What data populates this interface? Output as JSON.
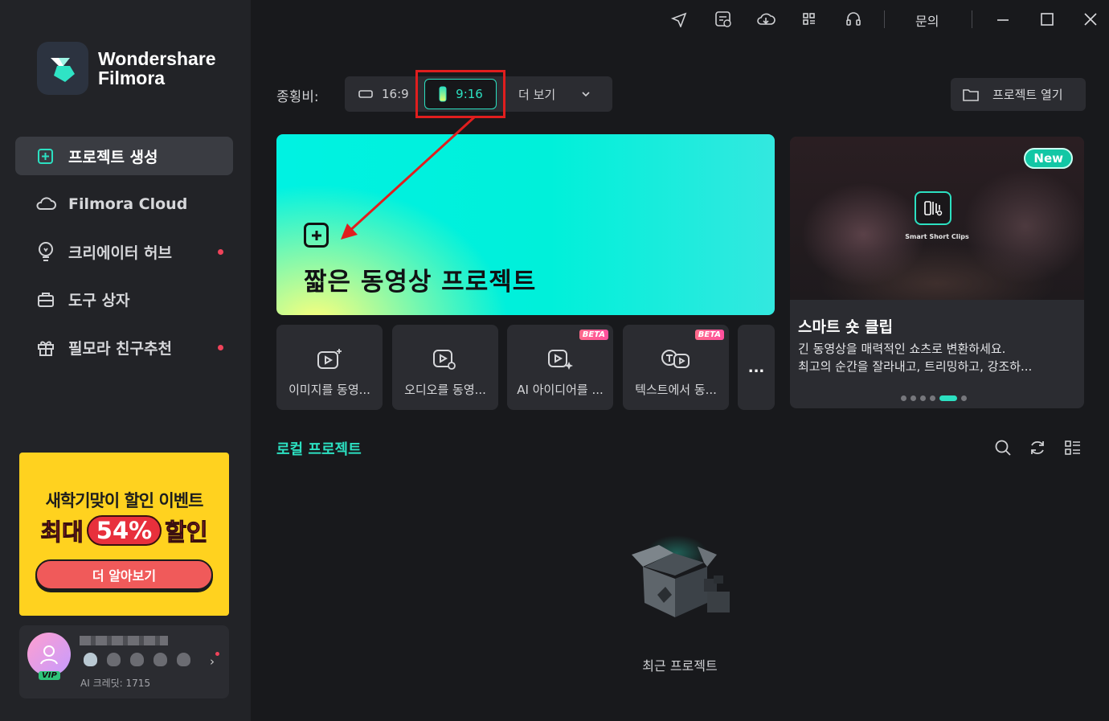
{
  "app": {
    "brand_line1": "Wondershare",
    "brand_line2": "Filmora"
  },
  "titlebar": {
    "contact_label": "문의",
    "icons": [
      "send-icon",
      "task-list-icon",
      "cloud-download-icon",
      "grid-apps-icon",
      "headset-icon"
    ]
  },
  "sidebar": {
    "items": [
      {
        "label": "프로젝트 생성",
        "icon": "new-project-icon",
        "active": true,
        "dot": false
      },
      {
        "label": "Filmora Cloud",
        "icon": "cloud-icon",
        "active": false,
        "dot": false
      },
      {
        "label": "크리에이터 허브",
        "icon": "bulb-icon",
        "active": false,
        "dot": true
      },
      {
        "label": "도구 상자",
        "icon": "toolbox-icon",
        "active": false,
        "dot": false
      },
      {
        "label": "필모라 친구추천",
        "icon": "gift-icon",
        "active": false,
        "dot": true
      }
    ],
    "promo": {
      "line1": "새학기맞이 할인 이벤트",
      "line2_prefix": "최대",
      "line2_pill": "54%",
      "line2_suffix": "할인",
      "button": "더 알아보기"
    },
    "user": {
      "vip_label": "VIP",
      "credits": "AI 크레딧: 1715"
    }
  },
  "aspect": {
    "label": "종횡비:",
    "options": [
      {
        "label": "16:9",
        "selected": false
      },
      {
        "label": "9:16",
        "selected": true
      }
    ],
    "more_label": "더 보기"
  },
  "open_project_label": "프로젝트 열기",
  "main_card": {
    "title": "짧은 동영상 프로젝트"
  },
  "tools": [
    {
      "label": "이미지를 동영...",
      "beta": false,
      "icon": "image-to-video-icon"
    },
    {
      "label": "오디오를 동영...",
      "beta": false,
      "icon": "audio-to-video-icon"
    },
    {
      "label": "AI 아이디어를 ...",
      "beta": true,
      "icon": "ai-idea-video-icon"
    },
    {
      "label": "텍스트에서 동...",
      "beta": true,
      "icon": "text-to-video-icon"
    }
  ],
  "beta_label": "BETA",
  "more_tools_label": "...",
  "feature": {
    "new_label": "New",
    "overlay_caption": "Smart Short Clips",
    "title": "스마트 숏 클립",
    "desc_line1": "긴 동영상을 매력적인 쇼츠로 변환하세요.",
    "desc_line2": "최고의 순간을 잘라내고, 트리밍하고, 강조하...",
    "carousel_count": 6,
    "carousel_active": 5
  },
  "local": {
    "title": "로컬 프로젝트",
    "empty_label": "최근 프로젝트"
  },
  "colors": {
    "accent": "#2ce0c1",
    "highlight_box": "#e01e1e",
    "sidebar_bg": "#222327",
    "main_bg": "#18191c"
  }
}
